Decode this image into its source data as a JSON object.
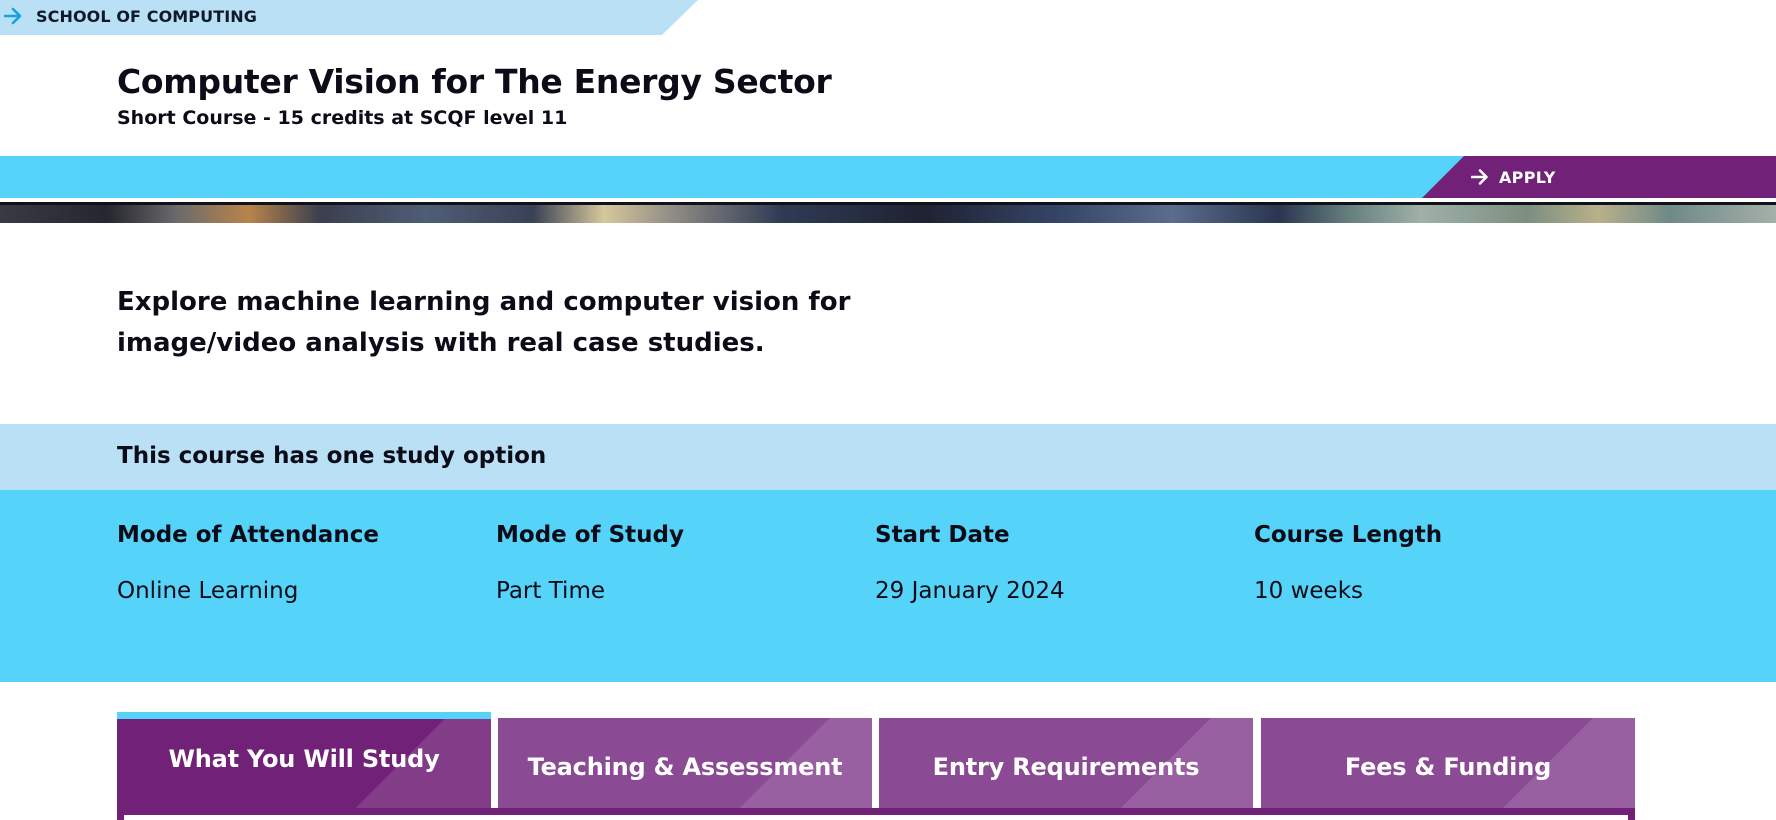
{
  "school": {
    "label": "SCHOOL OF COMPUTING",
    "icon": "arrow-right-icon"
  },
  "course": {
    "title": "Computer Vision for The Energy Sector",
    "subtitle": "Short Course - 15 credits at SCQF level 11"
  },
  "apply": {
    "label": "APPLY",
    "icon": "arrow-right-icon"
  },
  "intro": "Explore machine learning and computer vision for image/video analysis with real case studies.",
  "study": {
    "heading": "This course has one study option",
    "details": [
      {
        "head": "Mode of Attendance",
        "value": "Online Learning"
      },
      {
        "head": "Mode of Study",
        "value": "Part Time"
      },
      {
        "head": "Start Date",
        "value": "29 January 2024"
      },
      {
        "head": "Course Length",
        "value": "10 weeks"
      }
    ]
  },
  "tabs": [
    {
      "label": "What You Will Study",
      "active": true
    },
    {
      "label": "Teaching & Assessment",
      "active": false
    },
    {
      "label": "Entry Requirements",
      "active": false
    },
    {
      "label": "Fees & Funding",
      "active": false
    }
  ],
  "colors": {
    "light_blue": "#b9e0f5",
    "cyan": "#56d3f8",
    "purple": "#712177",
    "tab_purple": "#8a4a94",
    "school_arrow": "#1a9fe0"
  }
}
